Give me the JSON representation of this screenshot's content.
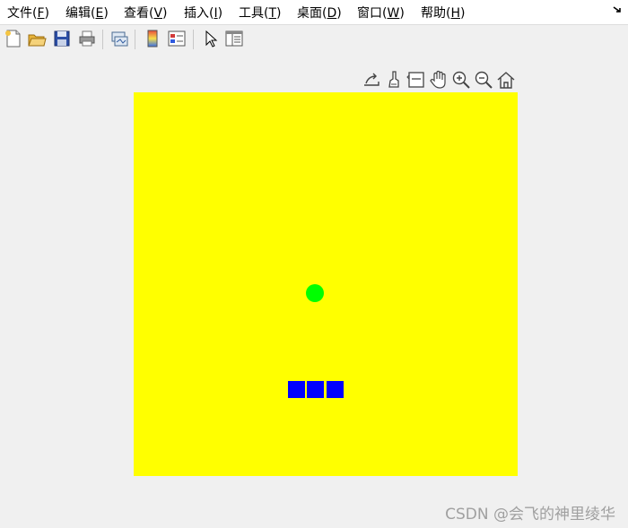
{
  "menubar": {
    "items": [
      {
        "label": "文件(",
        "key": "F",
        "close": ")"
      },
      {
        "label": "编辑(",
        "key": "E",
        "close": ")"
      },
      {
        "label": "查看(",
        "key": "V",
        "close": ")"
      },
      {
        "label": "插入(",
        "key": "I",
        "close": ")"
      },
      {
        "label": "工具(",
        "key": "T",
        "close": ")"
      },
      {
        "label": "桌面(",
        "key": "D",
        "close": ")"
      },
      {
        "label": "窗口(",
        "key": "W",
        "close": ")"
      },
      {
        "label": "帮助(",
        "key": "H",
        "close": ")"
      }
    ],
    "corner_icon": "dock-arrow-icon"
  },
  "toolbar": {
    "icons": [
      "new-figure-icon",
      "open-file-icon",
      "save-icon",
      "print-icon",
      "link-plot-icon",
      "colorbar-icon",
      "legend-icon",
      "edit-plot-pointer-icon",
      "property-inspector-icon"
    ]
  },
  "axes_toolbar": {
    "icons": [
      "export-icon",
      "brush-icon",
      "data-tips-icon",
      "pan-icon",
      "zoom-in-icon",
      "zoom-out-icon",
      "restore-view-icon"
    ]
  },
  "figure": {
    "background_color": "#ffff00",
    "ball_color": "#00ff00",
    "block_color": "#0000ff",
    "block_count": 3
  },
  "watermark": {
    "text": "CSDN @会飞的神里绫华"
  }
}
